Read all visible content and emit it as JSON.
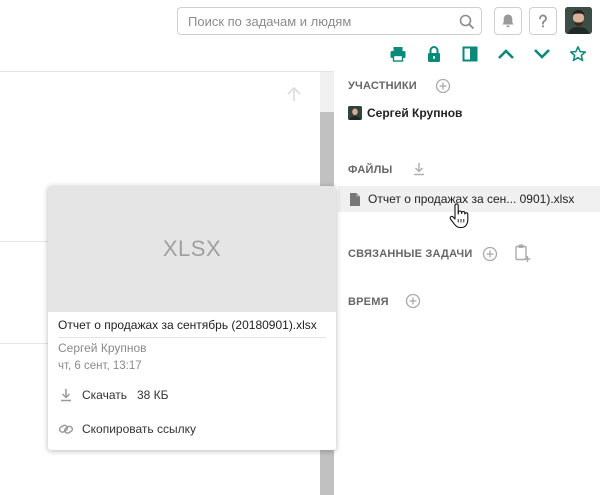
{
  "header": {
    "search_placeholder": "Поиск по задачам и людям",
    "icons": [
      "search-icon",
      "bell-icon",
      "help-icon",
      "user-avatar"
    ]
  },
  "toolbar": {
    "icons": [
      "print-icon",
      "lock-icon",
      "panel-toggle-icon",
      "chevron-up-icon",
      "chevron-down-icon",
      "star-icon"
    ],
    "accent_color": "#0a8a7a"
  },
  "panel": {
    "participants": {
      "title": "УЧАСТНИКИ",
      "people": [
        {
          "name": "Сергей Крупнов"
        }
      ]
    },
    "files": {
      "title": "ФАЙЛЫ",
      "items": [
        {
          "name": "Отчет о продажах за сен... 0901).xlsx"
        }
      ]
    },
    "related": {
      "title": "СВЯЗАННЫЕ ЗАДАЧИ"
    },
    "time": {
      "title": "ВРЕМЯ"
    }
  },
  "file_card": {
    "preview_label": "XLSX",
    "full_name": "Отчет о продажах за сентябрь (20180901).xlsx",
    "author": "Сергей Крупнов",
    "date": "чт, 6 сент, 13:17",
    "download_label": "Скачать",
    "size": "38 КБ",
    "copy_link_label": "Скопировать ссылку"
  }
}
